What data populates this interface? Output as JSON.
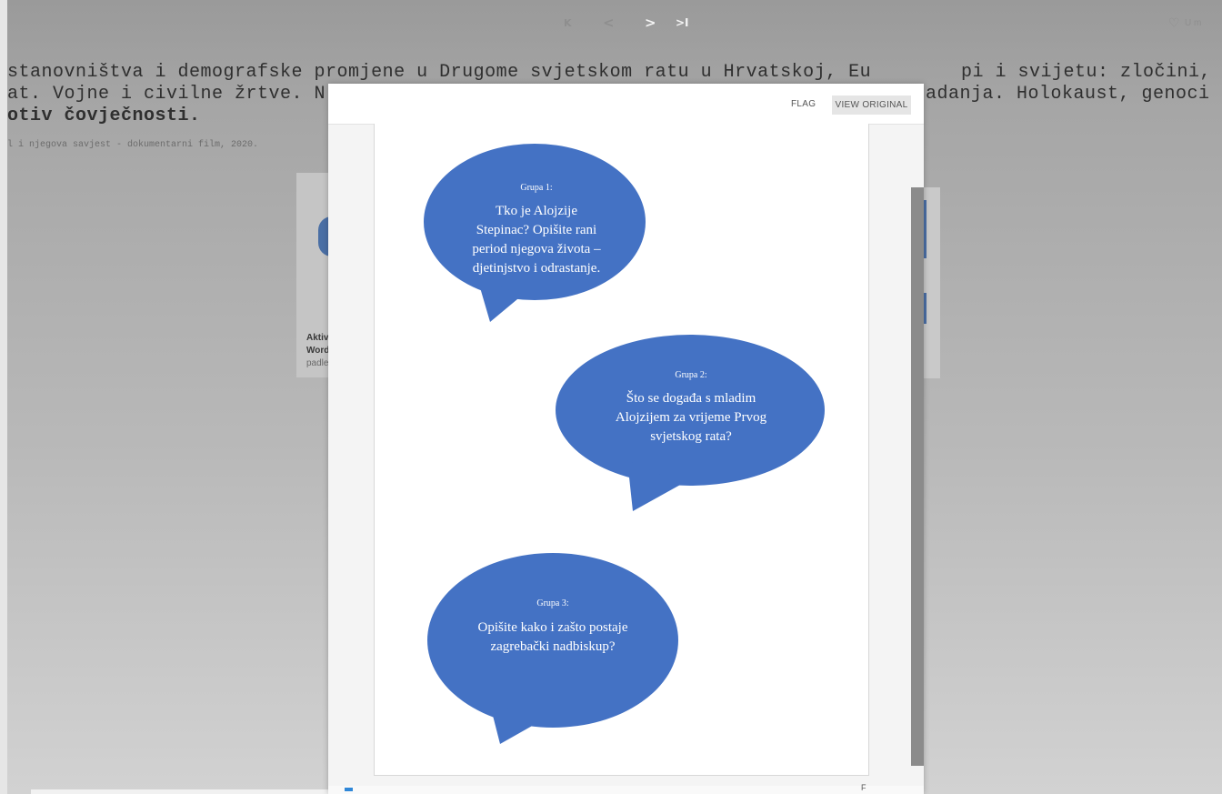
{
  "nav": {
    "first": "K",
    "prev": "<",
    "next": ">",
    "last": ">I",
    "save_label": "U m"
  },
  "background_page": {
    "title_line1": "stanovništva i demografske promjene u Drugome svjetskom ratu u Hrvatskoj, Eu",
    "title_line1_right": "pi i svijetu: zločini, st",
    "title_line2": "at. Vojne i civilne žrtve. N",
    "title_line2_right": "adanja. Holokaust, genoci",
    "title_line3": "otiv čovječnosti.",
    "subtitle": "l i njegova savjest - dokumentarni film, 2020.",
    "card_text1": "Aktiv",
    "card_text2": "Word",
    "card_text3": "padle"
  },
  "modal": {
    "flag_label": "FLAG",
    "view_original_label": "VIEW ORIGINAL",
    "footer_text": "F"
  },
  "document": {
    "bubbles": [
      {
        "group": "Grupa 1:",
        "lines": [
          "Tko je Alojzije",
          "Stepinac? Opišite rani",
          "period njegova života –",
          "djetinjstvo i odrastanje."
        ]
      },
      {
        "group": "Grupa 2:",
        "lines": [
          "Što se događa s mladim",
          "Alojzijem za vrijeme Prvog",
          "svjetskog rata?"
        ]
      },
      {
        "group": "Grupa 3:",
        "lines": [
          "Opišite kako i zašto postaje",
          "zagrebački nadbiskup?"
        ]
      }
    ],
    "bubble_color": "#4472c4"
  }
}
